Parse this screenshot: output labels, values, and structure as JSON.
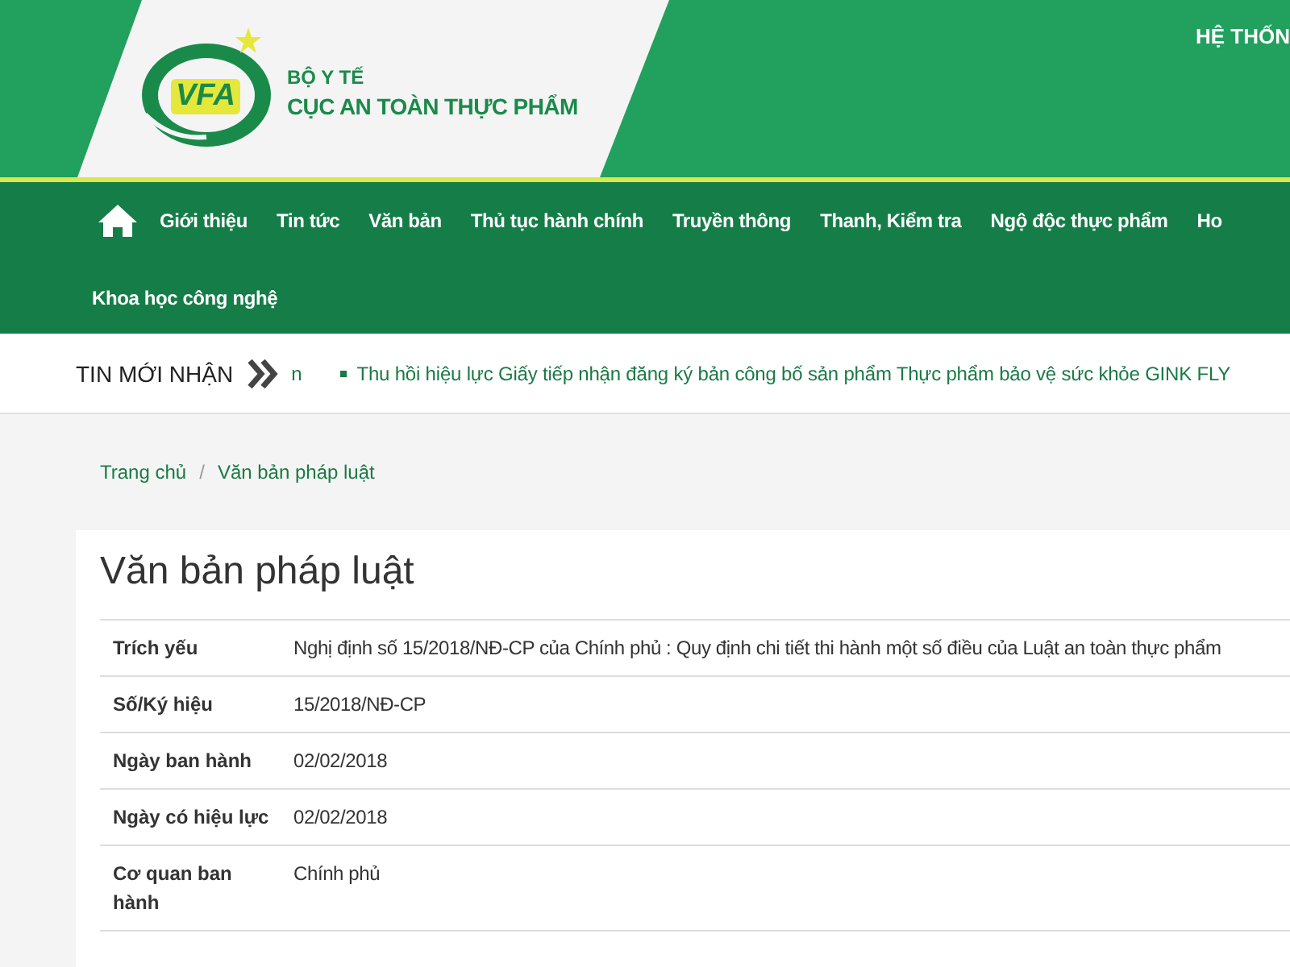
{
  "header": {
    "ministry": "BỘ Y TẾ",
    "agency": "CỤC AN TOÀN THỰC PHẨM",
    "logo_text": "VFA",
    "top_link": "HỆ THỐN"
  },
  "nav": {
    "items": [
      "Giới thiệu",
      "Tin tức",
      "Văn bản",
      "Thủ tục hành chính",
      "Truyền thông",
      "Thanh, Kiểm tra",
      "Ngộ độc thực phẩm",
      "Ho",
      "Khoa học công nghệ"
    ]
  },
  "ticker": {
    "label": "TIN MỚI NHẬN",
    "fragment": "n",
    "headline": "Thu hồi hiệu lực Giấy tiếp nhận đăng ký bản công bố sản phẩm Thực phẩm bảo vệ sức khỏe GINK FLY"
  },
  "breadcrumb": [
    "Trang chủ",
    "Văn bản pháp luật"
  ],
  "breadcrumb_separator": "/",
  "document": {
    "title": "Văn bản pháp luật",
    "rows": [
      {
        "label": "Trích yếu",
        "value": "Nghị định số 15/2018/NĐ-CP của Chính phủ : Quy định chi tiết thi hành một số điều của Luật an toàn thực phẩm"
      },
      {
        "label": "Số/Ký hiệu",
        "value": "15/2018/NĐ-CP"
      },
      {
        "label": "Ngày ban hành",
        "value": "02/02/2018"
      },
      {
        "label": "Ngày có hiệu lực",
        "value": "02/02/2018"
      },
      {
        "label": "Cơ quan ban hành",
        "value": "Chính phủ"
      }
    ]
  }
}
